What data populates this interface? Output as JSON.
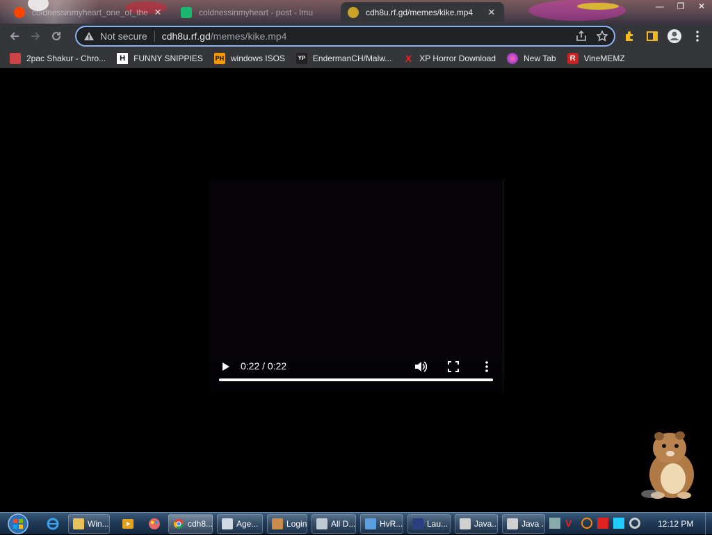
{
  "browser": {
    "tabs": [
      {
        "title": "coldnessinmyheart_one_of_the",
        "active": false
      },
      {
        "title": "coldnessinmyheart - post - Imu",
        "active": false
      },
      {
        "title": "cdh8u.rf.gd/memes/kike.mp4",
        "active": true
      }
    ],
    "address": {
      "security_label": "Not secure",
      "host": "cdh8u.rf.gd",
      "path": "/memes/kike.mp4"
    },
    "bookmarks": [
      {
        "label": "2pac Shakur - Chro...",
        "icon": "page-icon"
      },
      {
        "label": "FUNNY SNIPPIES",
        "icon": "H"
      },
      {
        "label": "windows ISOS",
        "icon": "PH"
      },
      {
        "label": "EndermanCH/Malw...",
        "icon": "YP"
      },
      {
        "label": "XP Horror Download",
        "icon": "X"
      },
      {
        "label": "New Tab",
        "icon": "globe-icon"
      },
      {
        "label": "VineMEMZ",
        "icon": "R"
      }
    ]
  },
  "video_player": {
    "time": "0:22 / 0:22",
    "progress": 1.0
  },
  "taskbar": {
    "items": [
      {
        "label": "Win...",
        "icon": "folder-icon",
        "active": false
      },
      {
        "label": "cdh8...",
        "icon": "chrome-icon",
        "active": true
      },
      {
        "label": "Age...",
        "icon": "window-icon",
        "active": false
      },
      {
        "label": "Login",
        "icon": "app-icon",
        "active": false
      },
      {
        "label": "All D...",
        "icon": "window-icon",
        "active": false
      },
      {
        "label": "HvR...",
        "icon": "app-icon",
        "active": false
      },
      {
        "label": "Lau...",
        "icon": "app-icon",
        "active": false
      },
      {
        "label": "Java...",
        "icon": "java-icon",
        "active": false
      },
      {
        "label": "Java ...",
        "icon": "java-icon",
        "active": false
      }
    ],
    "clock": "12:12 PM"
  },
  "colors": {
    "chrome_toolbar": "#35363a",
    "omnibox_focus": "#8ab4f8",
    "taskbar": "#1f3a58"
  }
}
